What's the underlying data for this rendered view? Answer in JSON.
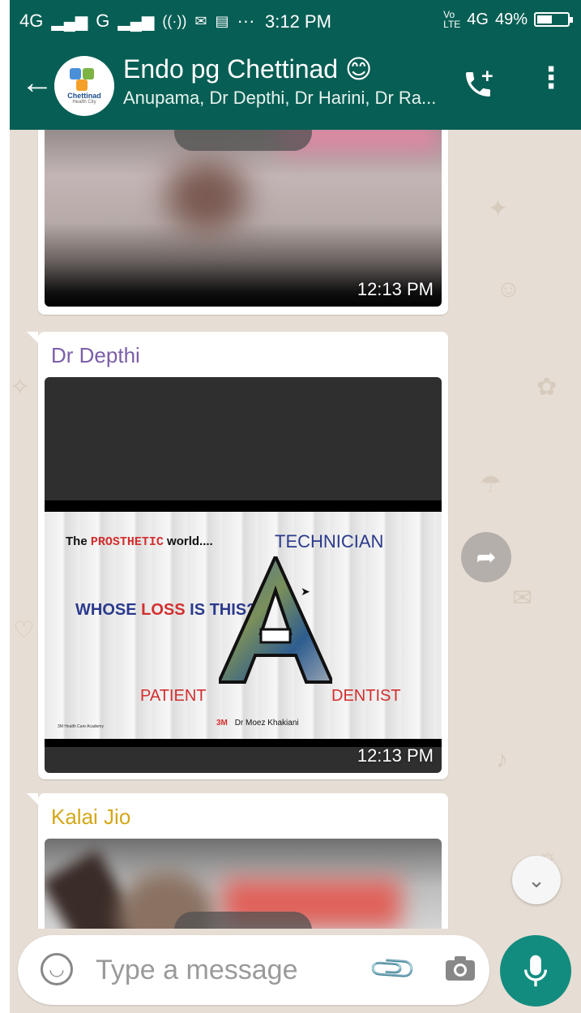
{
  "status_bar": {
    "network_left": "4G",
    "network_second": "G",
    "time": "3:12 PM",
    "network_right": "4G",
    "battery": "49%",
    "battery_level": 0.49
  },
  "header": {
    "title": "Endo pg Chettinad 😊",
    "subtitle": "Anupama, Dr Depthi, Dr Harini, Dr Ra...",
    "avatar_text": "Chettinad",
    "avatar_subtext": "Health City"
  },
  "messages": [
    {
      "sender": "",
      "time": "12:13 PM"
    },
    {
      "sender": "Dr Depthi",
      "sender_color": "#7b5fa8",
      "time": "12:13 PM",
      "slide": {
        "line1_a": "The",
        "line1_b": "PROSTHETIC",
        "line1_c": "world....",
        "technician": "TECHNICIAN",
        "question_a": "WHOSE",
        "question_b": "LOSS",
        "question_c": "IS THIS?",
        "patient": "PATIENT",
        "dentist": "DENTIST",
        "brand": "3M",
        "author": "Dr Moez Khakiani",
        "footer_left": "3M Health Care Academy"
      }
    },
    {
      "sender": "Kalai Jio",
      "sender_color": "#d4a71a"
    }
  ],
  "input": {
    "placeholder": "Type a message"
  },
  "colors": {
    "header": "#075e54",
    "accent": "#128c7e",
    "chat_bg": "#e6ddd4"
  }
}
